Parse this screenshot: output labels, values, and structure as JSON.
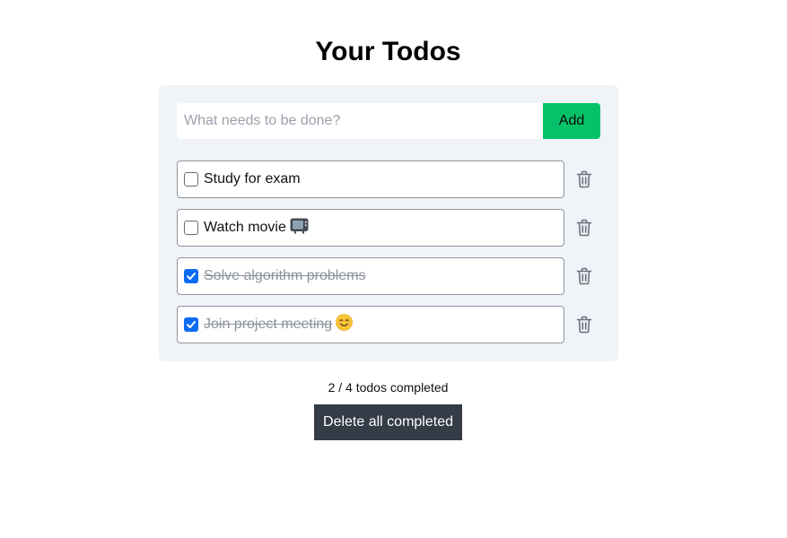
{
  "page": {
    "title": "Your Todos"
  },
  "form": {
    "placeholder": "What needs to be done?",
    "add_label": "Add"
  },
  "todos": [
    {
      "text": "Study for exam",
      "emoji": "",
      "completed": false
    },
    {
      "text": "Watch movie",
      "emoji": "tv-emoji",
      "completed": false
    },
    {
      "text": "Solve algorithm problems",
      "emoji": "",
      "completed": true
    },
    {
      "text": "Join project meeting",
      "emoji": "smiling-face-emoji",
      "completed": true
    }
  ],
  "footer": {
    "summary": "2 / 4 todos completed",
    "delete_completed_label": "Delete all completed"
  },
  "colors": {
    "card_bg": "#f0f3f7",
    "add_button": "#05c26a",
    "checkbox_checked": "#0b6cf3",
    "delete_button": "#343c47",
    "completed_text": "#8b919b"
  },
  "icons": {
    "delete": "trash-icon",
    "check": "checkmark-icon"
  }
}
